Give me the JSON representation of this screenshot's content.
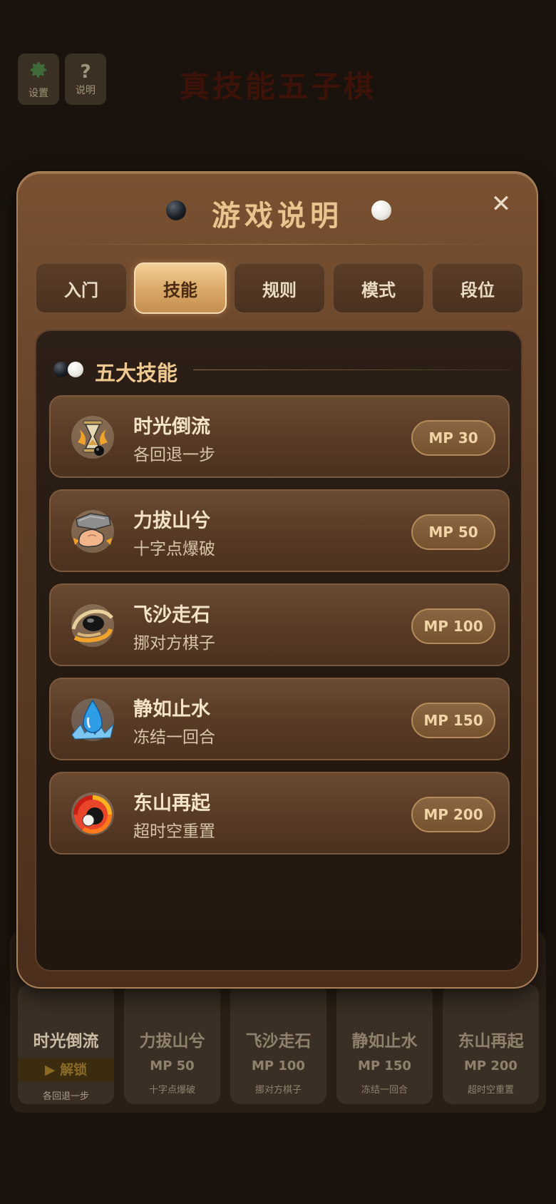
{
  "background": {
    "top_buttons": [
      {
        "icon": "gear-icon",
        "label": "设置"
      },
      {
        "icon": "question-icon",
        "glyph": "?",
        "label": "说明"
      }
    ],
    "game_title": "真技能五子棋",
    "skill_bar": [
      {
        "name": "时光倒流",
        "action": "▶ 解锁",
        "desc": "各回退一步"
      },
      {
        "name": "力拔山兮",
        "mp": "MP 50",
        "desc": "十字点爆破"
      },
      {
        "name": "飞沙走石",
        "mp": "MP 100",
        "desc": "挪对方棋子"
      },
      {
        "name": "静如止水",
        "mp": "MP 150",
        "desc": "冻结一回合"
      },
      {
        "name": "东山再起",
        "mp": "MP 200",
        "desc": "超时空重置"
      }
    ]
  },
  "modal": {
    "title": "游戏说明",
    "close_glyph": "✕",
    "tabs": [
      {
        "label": "入门",
        "active": false
      },
      {
        "label": "技能",
        "active": true
      },
      {
        "label": "规则",
        "active": false
      },
      {
        "label": "模式",
        "active": false
      },
      {
        "label": "段位",
        "active": false
      }
    ],
    "section_title": "五大技能",
    "skills": [
      {
        "name": "时光倒流",
        "desc": "各回退一步",
        "mp": "MP 30",
        "icon": "hourglass-icon"
      },
      {
        "name": "力拔山兮",
        "desc": "十字点爆破",
        "mp": "MP 50",
        "icon": "muscle-rock-icon"
      },
      {
        "name": "飞沙走石",
        "desc": "挪对方棋子",
        "mp": "MP 100",
        "icon": "whirlwind-stone-icon"
      },
      {
        "name": "静如止水",
        "desc": "冻结一回合",
        "mp": "MP 150",
        "icon": "water-drop-icon"
      },
      {
        "name": "东山再起",
        "desc": "超时空重置",
        "mp": "MP 200",
        "icon": "fire-vortex-icon"
      }
    ]
  },
  "colors": {
    "accent_gold": "#e9c48e",
    "active_tab": "#d9a867",
    "panel_bg": "#24190f"
  }
}
